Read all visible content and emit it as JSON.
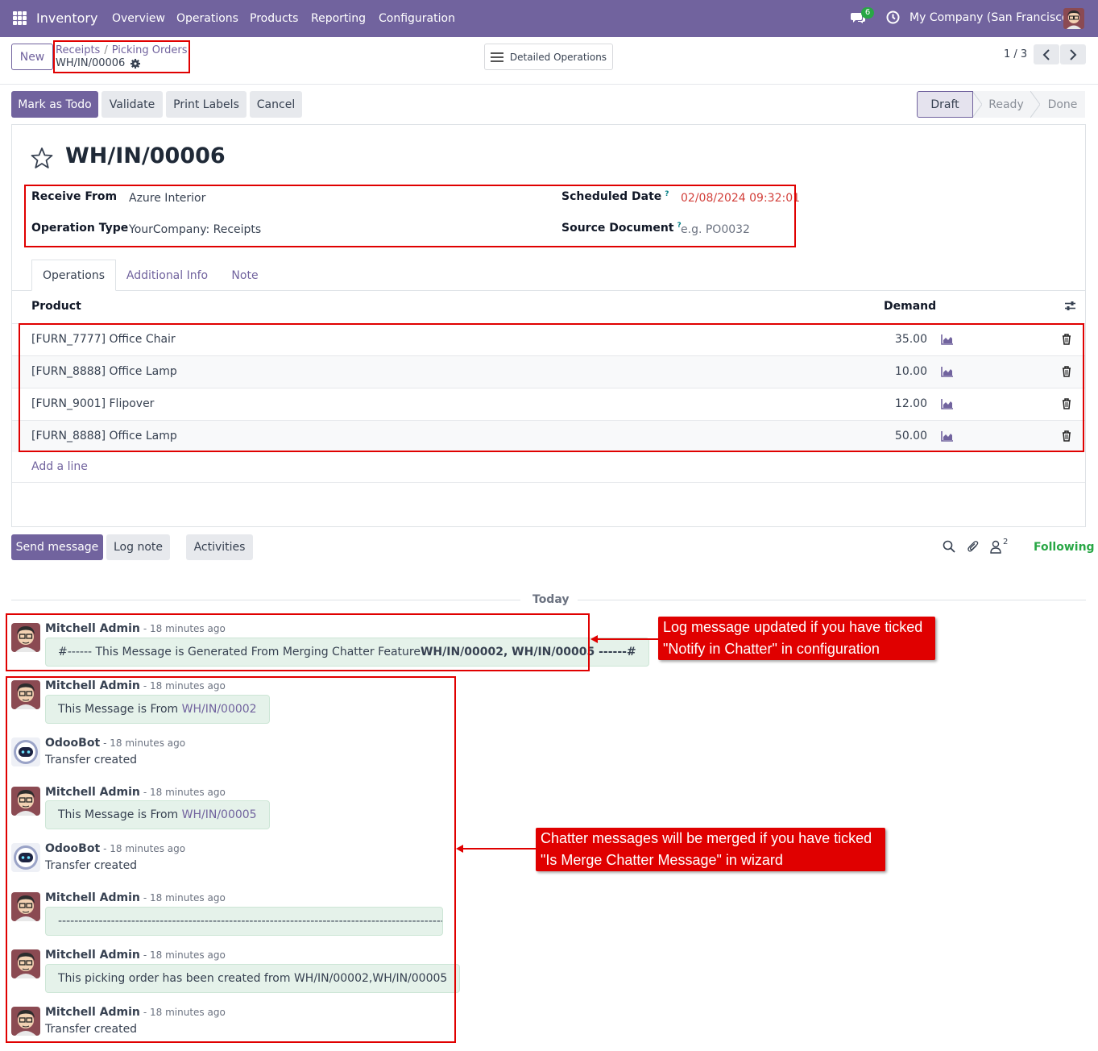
{
  "navbar": {
    "brand": "Inventory",
    "menu": [
      "Overview",
      "Operations",
      "Products",
      "Reporting",
      "Configuration"
    ],
    "chat_badge": "6",
    "company": "My Company (San Francisco)"
  },
  "control_panel": {
    "new_label": "New",
    "breadcrumb_receipts": "Receipts",
    "breadcrumb_sep": "/",
    "breadcrumb_picking": "Picking Orders",
    "record_name": "WH/IN/00006",
    "detailed_operations": "Detailed Operations",
    "pager": "1 / 3"
  },
  "actions": {
    "mark_todo": "Mark as Todo",
    "validate": "Validate",
    "print_labels": "Print Labels",
    "cancel": "Cancel"
  },
  "status": [
    "Draft",
    "Ready",
    "Done"
  ],
  "form": {
    "title": "WH/IN/00006",
    "receive_from_label": "Receive From",
    "receive_from": "Azure Interior",
    "operation_type_label": "Operation Type",
    "operation_type": "YourCompany: Receipts",
    "scheduled_date_label": "Scheduled Date",
    "scheduled_date": "02/08/2024 09:32:01",
    "source_document_label": "Source Document",
    "source_document_placeholder": "e.g. PO0032",
    "help_mark": "?"
  },
  "tabs": [
    "Operations",
    "Additional Info",
    "Note"
  ],
  "table": {
    "col_product": "Product",
    "col_demand": "Demand",
    "rows": [
      {
        "product": "[FURN_7777] Office Chair",
        "demand": "35.00"
      },
      {
        "product": "[FURN_8888] Office Lamp",
        "demand": "10.00"
      },
      {
        "product": "[FURN_9001] Flipover",
        "demand": "12.00"
      },
      {
        "product": "[FURN_8888] Office Lamp",
        "demand": "50.00"
      }
    ],
    "add_line": "Add a line"
  },
  "chatter": {
    "send_message": "Send message",
    "log_note": "Log note",
    "activities": "Activities",
    "followers_count": "2",
    "following": "Following",
    "today": "Today",
    "messages": [
      {
        "author": "Mitchell Admin",
        "time": "- 18 minutes ago",
        "text_pre": "#------ This Message is Generated From Merging Chatter Feature ",
        "text_bold": "WH/IN/00002, WH/IN/00005 ------#"
      },
      {
        "author": "Mitchell Admin",
        "time": "- 18 minutes ago",
        "text_pre": "This Message is From ",
        "text_link": "WH/IN/00002"
      },
      {
        "author": "OdooBot",
        "time": "- 18 minutes ago",
        "text": "Transfer created"
      },
      {
        "author": "Mitchell Admin",
        "time": "- 18 minutes ago",
        "text_pre": "This Message is From ",
        "text_link": "WH/IN/00005"
      },
      {
        "author": "OdooBot",
        "time": "- 18 minutes ago",
        "text": "Transfer created"
      },
      {
        "author": "Mitchell Admin",
        "time": "- 18 minutes ago",
        "text": "-----------------------------------------------------------------------------------------------"
      },
      {
        "author": "Mitchell Admin",
        "time": "- 18 minutes ago",
        "text": "This picking order has been created from WH/IN/00002,WH/IN/00005"
      },
      {
        "author": "Mitchell Admin",
        "time": "- 18 minutes ago",
        "text": "Transfer created"
      }
    ]
  },
  "annotations": {
    "callout1_line1": "Log message updated if you have ticked",
    "callout1_line2": "\"Notify in Chatter\" in configuration",
    "callout2_line1": "Chatter messages will be merged if you have ticked",
    "callout2_line2": "\"Is Merge Chatter Message\" in wizard"
  },
  "colors": {
    "brand": "#71639e",
    "annotation_red": "#e00000",
    "following_green": "#28a745",
    "date_red": "#d23f3a"
  }
}
